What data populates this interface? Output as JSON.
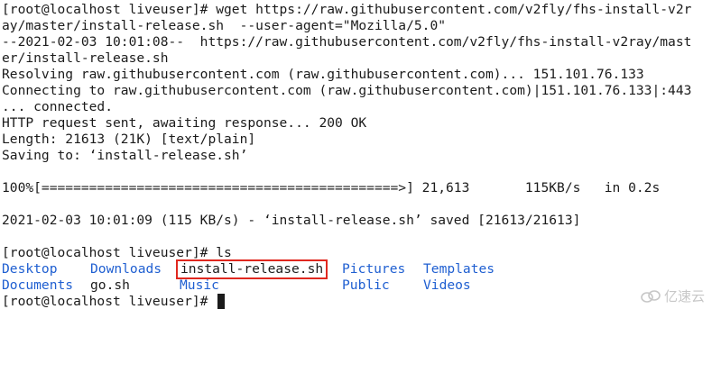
{
  "terminal": {
    "lines": [
      "[root@localhost liveuser]# wget https://raw.githubusercontent.com/v2fly/fhs-install-v2r",
      "ay/master/install-release.sh  --user-agent=\"Mozilla/5.0\"",
      "--2021-02-03 10:01:08--  https://raw.githubusercontent.com/v2fly/fhs-install-v2ray/mast",
      "er/install-release.sh",
      "Resolving raw.githubusercontent.com (raw.githubusercontent.com)... 151.101.76.133",
      "Connecting to raw.githubusercontent.com (raw.githubusercontent.com)|151.101.76.133|:443",
      "... connected.",
      "HTTP request sent, awaiting response... 200 OK",
      "Length: 21613 (21K) [text/plain]",
      "Saving to: ‘install-release.sh’",
      "",
      "100%[=============================================>] 21,613       115KB/s   in 0.2s",
      "",
      "2021-02-03 10:01:09 (115 KB/s) - ‘install-release.sh’ saved [21613/21613]",
      "",
      "[root@localhost liveuser]# ls"
    ],
    "ls_output": {
      "row1": {
        "desktop": "Desktop",
        "downloads": "Downloads",
        "install_release": "install-release.sh",
        "pictures": "Pictures",
        "templates": "Templates"
      },
      "row2": {
        "documents": "Documents",
        "go_sh": "go.sh",
        "music": "Music",
        "public": "Public",
        "videos": "Videos"
      }
    },
    "final_prompt": "[root@localhost liveuser]# "
  },
  "colors": {
    "directory": "#1f5fd1",
    "highlight_border": "#e0281f",
    "text": "#1b1b1b"
  },
  "watermark": {
    "text": "亿速云",
    "icon": "yisu-cloud-logo-icon"
  }
}
